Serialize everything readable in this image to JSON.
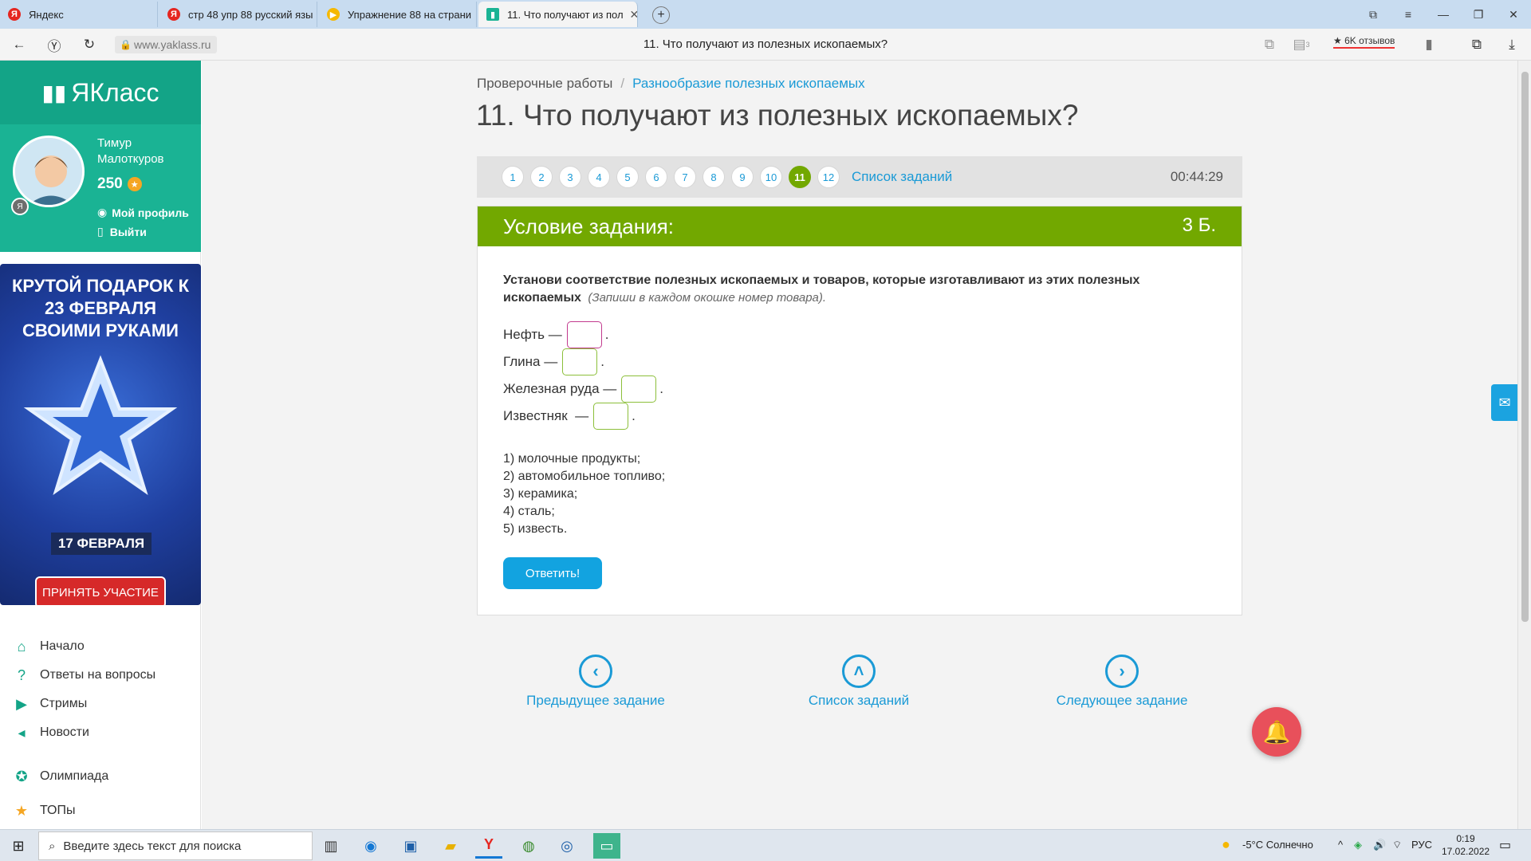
{
  "browser": {
    "tabs": [
      {
        "title": "Яндекс",
        "fav": "Я",
        "fav_color": "#e52620"
      },
      {
        "title": "стр 48 упр 88 русский язы",
        "fav": "Я",
        "fav_color": "#e52620"
      },
      {
        "title": "Упражнение 88 на страни",
        "fav": "▶",
        "fav_color": "#f5b800"
      },
      {
        "title": "11. Что получают из пол",
        "fav": "▮▮",
        "fav_color": "#1ab394"
      }
    ],
    "url": "www.yaklass.ru",
    "page_title": "11. Что получают из полезных ископаемых?",
    "reviews": "★ 6K отзывов",
    "tab_badge": "3"
  },
  "sidebar": {
    "logo": "ЯКласс",
    "user_first": "Тимур",
    "user_last": "Малоткуров",
    "points": "250",
    "profile_link": "Мой профиль",
    "logout_link": "Выйти",
    "promo": {
      "title": "КРУТОЙ ПОДАРОК К 23 ФЕВРАЛЯ СВОИМИ РУКАМИ",
      "date": "17 ФЕВРАЛЯ",
      "button": "ПРИНЯТЬ УЧАСТИЕ"
    },
    "menu": [
      "Начало",
      "Ответы на вопросы",
      "Стримы",
      "Новости",
      "Олимпиада",
      "ТОПы"
    ]
  },
  "main": {
    "breadcrumb_root": "Проверочные работы",
    "breadcrumb_sep": "/",
    "breadcrumb_current": "Разнообразие полезных ископаемых",
    "title": "11. Что получают из полезных ископаемых?",
    "pages": [
      "1",
      "2",
      "3",
      "4",
      "5",
      "6",
      "7",
      "8",
      "9",
      "10",
      "11",
      "12"
    ],
    "current_page": "11",
    "task_list_link": "Список заданий",
    "timer": "00:44:29",
    "card_title": "Условие задания:",
    "points": "3 Б.",
    "task_text": "Установи соответствие полезных ископаемых и товаров, которые изготавливают из этих полезных ископаемых",
    "task_hint": "(Запиши в каждом окошке номер товара).",
    "rows": [
      {
        "label": "Нефть —"
      },
      {
        "label": "Глина —"
      },
      {
        "label": "Железная руда —"
      },
      {
        "label": "Известняк  —"
      }
    ],
    "period": ".",
    "options": [
      "1) молочные продукты;",
      "2) автомобильное топливо;",
      "3) керамика;",
      "4) сталь;",
      "5) известь."
    ],
    "submit": "Ответить!",
    "nav_prev": "Предыдущее задание",
    "nav_list": "Список заданий",
    "nav_next": "Следующее задание"
  },
  "taskbar": {
    "search_placeholder": "Введите здесь текст для поиска",
    "weather": "-5°C  Солнечно",
    "lang": "РУС",
    "time": "0:19",
    "date": "17.02.2022"
  }
}
